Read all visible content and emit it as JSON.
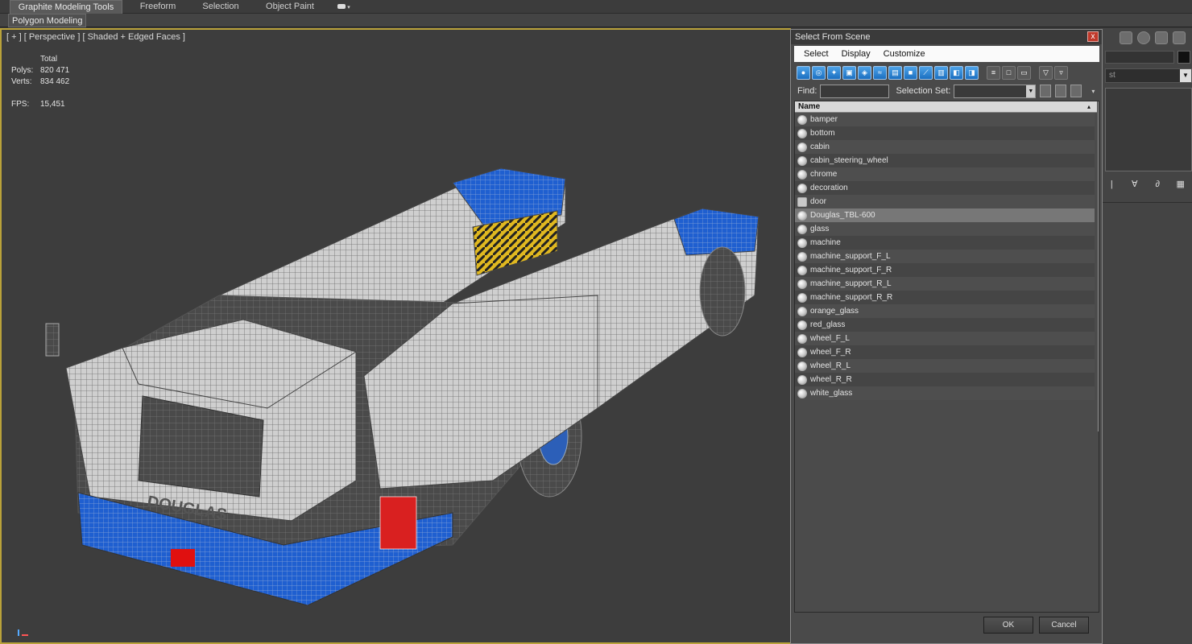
{
  "ribbon": {
    "tabs": [
      {
        "label": "Graphite Modeling Tools",
        "active": true
      },
      {
        "label": "Freeform",
        "active": false
      },
      {
        "label": "Selection",
        "active": false
      },
      {
        "label": "Object Paint",
        "active": false
      }
    ],
    "sub_panel": "Polygon Modeling"
  },
  "viewport": {
    "label": "[ + ] [ Perspective ] [ Shaded + Edged Faces ]",
    "stats": {
      "total_label": "Total",
      "polys_label": "Polys:",
      "polys_value": "820 471",
      "verts_label": "Verts:",
      "verts_value": "834 462",
      "fps_label": "FPS:",
      "fps_value": "15,451"
    },
    "stat_color": "#e4d43a",
    "frame_color": "#b9a23a",
    "model_text": "DOUGLAS"
  },
  "command_panel": {
    "dropdown_text": "st"
  },
  "dialog": {
    "title": "Select From Scene",
    "close_glyph": "x",
    "menu": [
      "Select",
      "Display",
      "Customize"
    ],
    "find_label": "Find:",
    "find_value": "",
    "selection_set_label": "Selection Set:",
    "column_header": "Name",
    "items": [
      {
        "name": "bamper",
        "type": "object"
      },
      {
        "name": "bottom",
        "type": "object"
      },
      {
        "name": "cabin",
        "type": "object"
      },
      {
        "name": "cabin_steering_wheel",
        "type": "object"
      },
      {
        "name": "chrome",
        "type": "object"
      },
      {
        "name": "decoration",
        "type": "object"
      },
      {
        "name": "door",
        "type": "group"
      },
      {
        "name": "Douglas_TBL-600",
        "type": "object",
        "selected": true
      },
      {
        "name": "glass",
        "type": "object"
      },
      {
        "name": "machine",
        "type": "object"
      },
      {
        "name": "machine_support_F_L",
        "type": "object"
      },
      {
        "name": "machine_support_F_R",
        "type": "object"
      },
      {
        "name": "machine_support_R_L",
        "type": "object"
      },
      {
        "name": "machine_support_R_R",
        "type": "object"
      },
      {
        "name": "orange_glass",
        "type": "object"
      },
      {
        "name": "red_glass",
        "type": "object"
      },
      {
        "name": "wheel_F_L",
        "type": "object"
      },
      {
        "name": "wheel_F_R",
        "type": "object"
      },
      {
        "name": "wheel_R_L",
        "type": "object"
      },
      {
        "name": "wheel_R_R",
        "type": "object"
      },
      {
        "name": "white_glass",
        "type": "object"
      }
    ],
    "ok_label": "OK",
    "cancel_label": "Cancel"
  }
}
